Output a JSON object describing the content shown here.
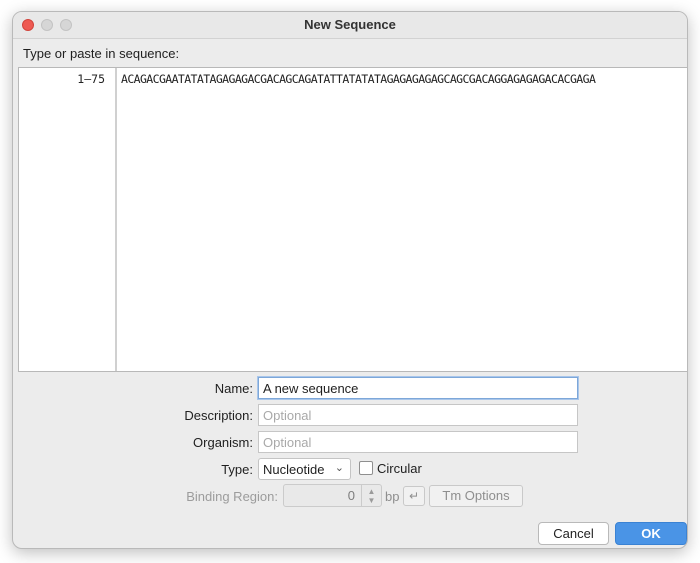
{
  "window": {
    "title": "New Sequence"
  },
  "prompt": "Type or paste in sequence:",
  "sequence": {
    "range": "1–75",
    "text": "ACAGACGAATATATAGAGAGACGACAGCAGATATTATATATAGAGAGAGAGCAGCGACAGGAGAGAGACACGAGA"
  },
  "form": {
    "name": {
      "label": "Name:",
      "value": "A new sequence"
    },
    "description": {
      "label": "Description:",
      "placeholder": "Optional"
    },
    "organism": {
      "label": "Organism:",
      "placeholder": "Optional"
    },
    "type": {
      "label": "Type:",
      "value": "Nucleotide"
    },
    "circular": {
      "label": "Circular",
      "checked": false
    },
    "binding_region": {
      "label": "Binding Region:",
      "value": "0",
      "unit": "bp",
      "tm_options": "Tm Options"
    }
  },
  "buttons": {
    "cancel": "Cancel",
    "ok": "OK"
  },
  "icons": {
    "enter": "return-arrow-icon",
    "dropdown": "chevron-down-icon",
    "spinner": "up-down-arrows-icon"
  }
}
